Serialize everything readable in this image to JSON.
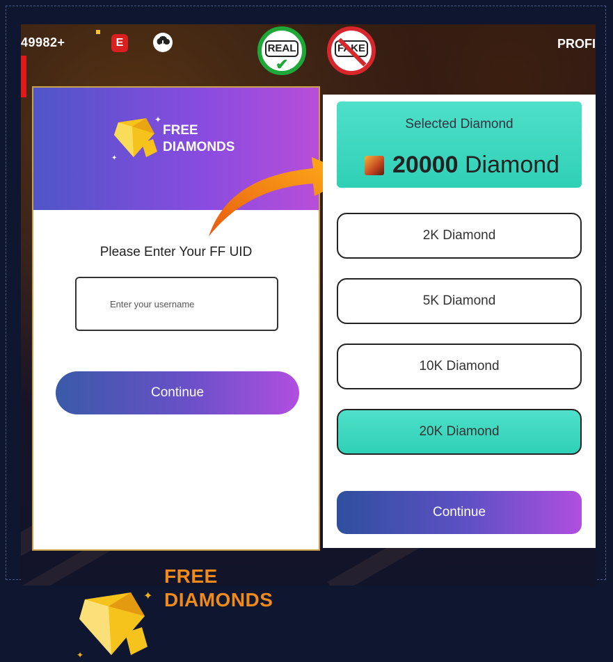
{
  "topbar": {
    "counter": "49982+",
    "badge_letter": "E",
    "cloud_icon": "cloud-download-icon",
    "profile_label": "PROFI"
  },
  "stamps": {
    "real_label": "REAL",
    "fake_label": "FAKE",
    "real_color": "#1ea83a",
    "fake_color": "#d7262c"
  },
  "left_panel": {
    "header_logo_line1": "FREE",
    "header_logo_line2": "DIAMONDS",
    "uid_label": "Please Enter Your FF UID",
    "uid_placeholder": "Enter your username",
    "uid_value": "",
    "continue_label": "Continue",
    "footer_logo_line1": "FREE",
    "footer_logo_line2": "DIAMONDS"
  },
  "right_panel": {
    "selected_title": "Selected Diamond",
    "selected_amount": "20000",
    "selected_unit": "Diamond",
    "options": [
      {
        "label": "2K Diamond",
        "selected": false
      },
      {
        "label": "5K Diamond",
        "selected": false
      },
      {
        "label": "10K Diamond",
        "selected": false
      },
      {
        "label": "20K Diamond",
        "selected": true
      }
    ],
    "continue_label": "Continue"
  },
  "colors": {
    "accent_teal": "#2fd0b6",
    "gradient_purple": "#b04fe0",
    "gradient_blue": "#3a5aa8",
    "logo_orange": "#f08a1a"
  }
}
